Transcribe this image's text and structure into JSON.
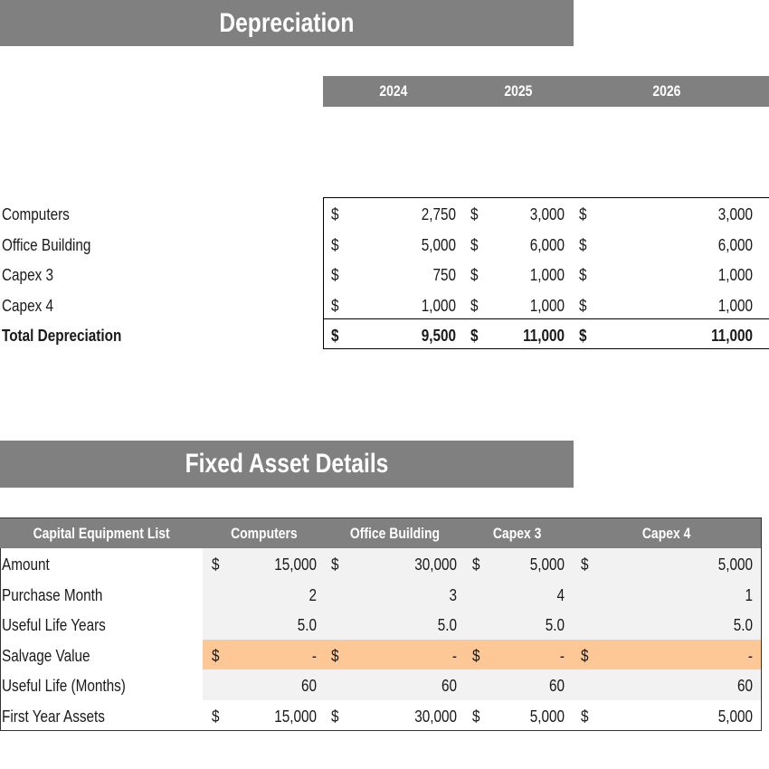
{
  "depreciation": {
    "title": "Depreciation",
    "years": [
      "2024",
      "2025",
      "2026"
    ],
    "currency": "$",
    "rows": [
      {
        "label": "Computers",
        "values": [
          "2,750",
          "3,000",
          "3,000"
        ]
      },
      {
        "label": "Office Building",
        "values": [
          "5,000",
          "6,000",
          "6,000"
        ]
      },
      {
        "label": "Capex 3",
        "values": [
          "750",
          "1,000",
          "1,000"
        ]
      },
      {
        "label": "Capex 4",
        "values": [
          "1,000",
          "1,000",
          "1,000"
        ]
      }
    ],
    "total": {
      "label": "Total Depreciation",
      "values": [
        "9,500",
        "11,000",
        "11,000"
      ]
    }
  },
  "fixed_assets": {
    "title": "Fixed Asset Details",
    "header_label": "Capital Equipment List",
    "columns": [
      "Computers",
      "Office Building",
      "Capex 3",
      "Capex 4"
    ],
    "currency": "$",
    "rows": [
      {
        "label": "Amount",
        "currency": true,
        "values": [
          "15,000",
          "30,000",
          "5,000",
          "5,000"
        ]
      },
      {
        "label": "Purchase Month",
        "currency": false,
        "values": [
          "2",
          "3",
          "4",
          "1"
        ]
      },
      {
        "label": "Useful Life Years",
        "currency": false,
        "values": [
          "5.0",
          "5.0",
          "5.0",
          "5.0"
        ]
      },
      {
        "label": "Salvage Value",
        "currency": true,
        "values": [
          "-",
          "-",
          "-",
          "-"
        ]
      },
      {
        "label": "Useful Life (Months)",
        "currency": false,
        "values": [
          "60",
          "60",
          "60",
          "60"
        ]
      },
      {
        "label": "First Year Assets",
        "currency": true,
        "values": [
          "15,000",
          "30,000",
          "5,000",
          "5,000"
        ]
      }
    ]
  },
  "colors": {
    "header_grey": "#808080",
    "input_highlight": "#fdc896",
    "cell_grey": "#f2f2f2"
  }
}
